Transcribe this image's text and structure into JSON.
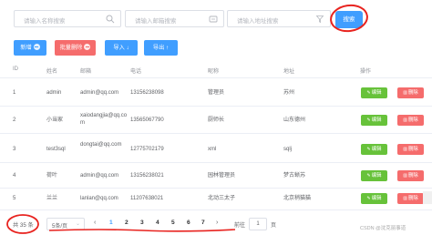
{
  "search": {
    "placeholder_1": "请输入名称搜索",
    "placeholder_2": "请输入邮箱搜索",
    "placeholder_3": "请输入地址搜索",
    "search_button": "搜索"
  },
  "actions": {
    "add_label": "新增",
    "batch_delete_label": "批量删除",
    "import_label": "导入",
    "export_label": "导出"
  },
  "table": {
    "headers": [
      "ID",
      "姓名",
      "邮箱",
      "电话",
      "昵称",
      "地址",
      "操作"
    ],
    "rows": [
      {
        "id": "1",
        "name": "admin",
        "email": "admin@qq.com",
        "phone": "13156238098",
        "nickname": "管理员",
        "address": "苏州"
      },
      {
        "id": "2",
        "name": "小当家",
        "email": "xaiodangjia@qq.co m",
        "phone": "13565067790",
        "nickname": "厨师长",
        "address": "山东德州"
      },
      {
        "id": "3",
        "name": "test3sql",
        "email": "dongtai@qq.com",
        "phone": "12775702179",
        "nickname": "xml",
        "address": "sqlj"
      },
      {
        "id": "4",
        "name": "荷叶",
        "email": "admin@qq.com",
        "phone": "13156238021",
        "nickname": "园林管理员",
        "address": "梦古蜥苏"
      },
      {
        "id": "5",
        "name": "兰兰",
        "email": "lanlan@qq.com",
        "phone": "11207638021",
        "nickname": "北动三太子",
        "address": "北京稍猫猫"
      }
    ],
    "edit_label": "编辑",
    "delete_label": "删除"
  },
  "pagination": {
    "total": "共 35 条",
    "page_size": "5条/页",
    "pages": [
      "1",
      "2",
      "3",
      "4",
      "5",
      "6",
      "7"
    ],
    "current_page": "1",
    "goto_label": "前往",
    "goto_value": "1",
    "goto_unit": "页"
  },
  "watermark": "CSDN @沈克丽事道",
  "colors": {
    "primary": "#409eff",
    "danger": "#f56c6c",
    "success": "#67c23a",
    "annotation": "#e8231f"
  }
}
